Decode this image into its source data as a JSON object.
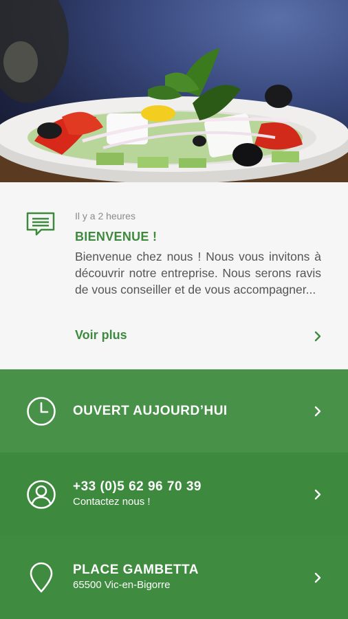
{
  "news": {
    "time": "Il y a 2 heures",
    "title": "BIENVENUE !",
    "body": "Bienvenue chez nous ! Nous vous invitons à découvrir notre entreprise. Nous serons ravis de vous conseiller et de vous accompagner...",
    "more_label": "Voir plus"
  },
  "rows": {
    "hours": {
      "label": "OUVERT AUJOURD’HUI",
      "icon": "clock-icon"
    },
    "phone": {
      "label": "+33 (0)5 62 96 70 39",
      "sub": "Contactez nous !",
      "icon": "user-circle-icon"
    },
    "address": {
      "label": "PLACE GAMBETTA",
      "sub": "65500 Vic-en-Bigorre",
      "icon": "location-pin-icon"
    }
  },
  "colors": {
    "accent": "#3d8a3f",
    "row1": "#479149",
    "row2": "#3d8a3f",
    "row3": "#3f8c40"
  }
}
